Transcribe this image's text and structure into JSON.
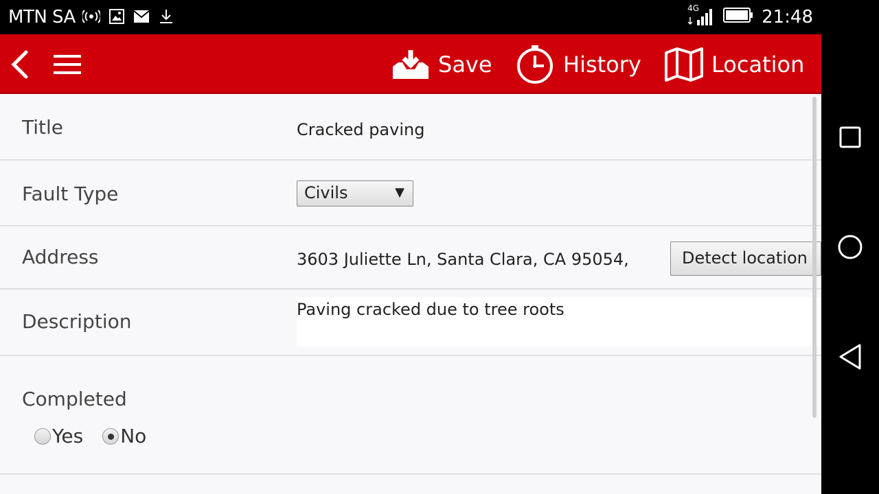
{
  "status": {
    "carrier": "MTN SA",
    "network": "4G",
    "time": "21:48"
  },
  "appbar": {
    "actions": {
      "save": "Save",
      "history": "History",
      "location": "Location"
    }
  },
  "form": {
    "title": {
      "label": "Title",
      "value": "Cracked paving"
    },
    "fault_type": {
      "label": "Fault Type",
      "selected": "Civils"
    },
    "address": {
      "label": "Address",
      "value": "3603 Juliette Ln, Santa Clara, CA 95054,",
      "detect_button": "Detect location"
    },
    "description": {
      "label": "Description",
      "value": "Paving cracked due to tree roots"
    },
    "completed": {
      "label": "Completed",
      "options": [
        "Yes",
        "No"
      ],
      "selected": "No"
    }
  },
  "colors": {
    "appbar": "#d0000a",
    "content_bg": "#f8f8fa"
  }
}
